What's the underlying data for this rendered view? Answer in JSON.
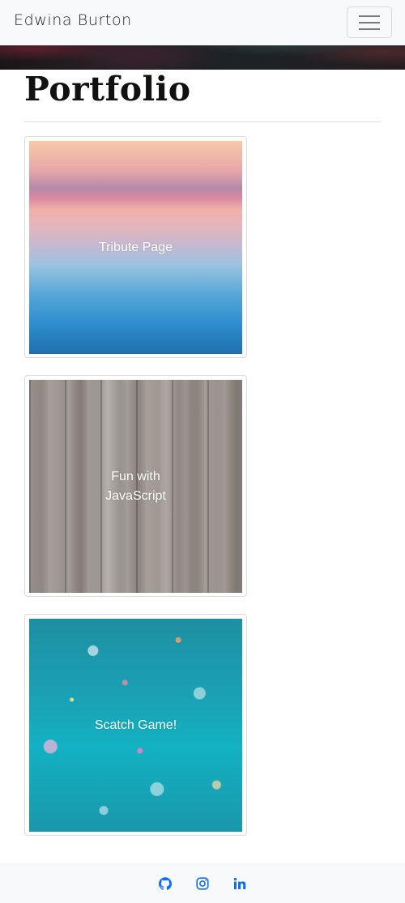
{
  "navbar": {
    "brand": "Edwina Burton",
    "toggler_label": "Toggle navigation"
  },
  "main": {
    "title": "Portfolio",
    "projects": [
      {
        "label": "Tribute Page"
      },
      {
        "label": "Fun with JavaScript"
      },
      {
        "label": "Scatch Game!"
      }
    ]
  },
  "footer": {
    "links": [
      {
        "icon": "github-icon"
      },
      {
        "icon": "instagram-icon"
      },
      {
        "icon": "linkedin-icon"
      }
    ]
  },
  "colors": {
    "navbar_bg": "#f8f9fa",
    "footer_icon": "#0d6efd",
    "card_label": "#ffffff"
  }
}
